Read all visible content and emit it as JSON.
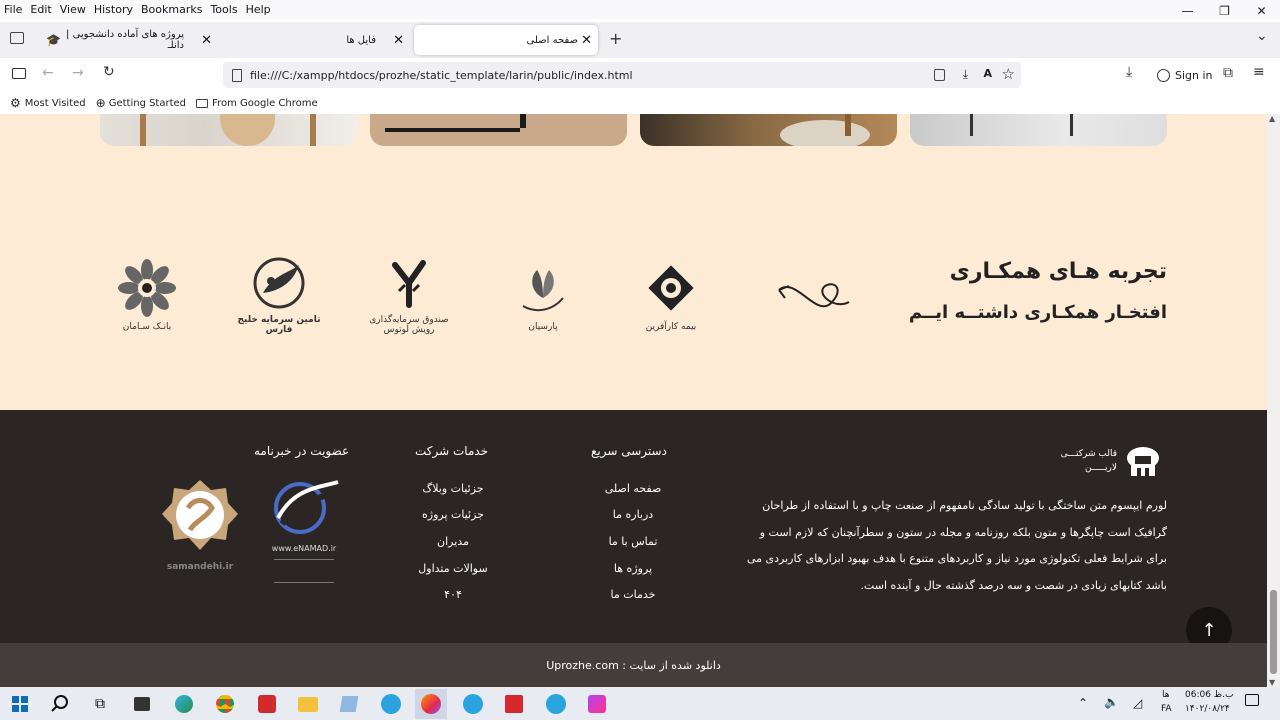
{
  "menu": [
    "File",
    "Edit",
    "View",
    "History",
    "Bookmarks",
    "Tools",
    "Help"
  ],
  "window_controls": {
    "minimize": "—",
    "maximize": "❐",
    "close": "✕"
  },
  "tabs": [
    {
      "label": "پروژه های آماده دانشجویی | دانلـ",
      "close": "✕"
    },
    {
      "label": "فایل ها",
      "close": "✕"
    },
    {
      "label": "صفحه اصلی",
      "close": "✕"
    }
  ],
  "new_tab": "+",
  "tab_list": "⌄",
  "url": "file:///C:/xampp/htdocs/prozhe/static_template/larin/public/index.html",
  "sign_in": "Sign in",
  "bookmarks": [
    "Most Visited",
    "Getting Started",
    "From Google Chrome"
  ],
  "cooperation": {
    "title": "تجربه هـای همکـاری",
    "subtitle": "افتخـار همکـاری داشتــه ایــم",
    "logos": [
      {
        "name": "bank-saman",
        "caption": "بانـک سـامان"
      },
      {
        "name": "khalij-fars",
        "caption": "تامین سرمایه خلیج فارس"
      },
      {
        "name": "lotus",
        "caption": "صندوق سرمایه‌گذاری رویش لوتوس"
      },
      {
        "name": "parsian",
        "caption": "پارسیان"
      },
      {
        "name": "karafarin",
        "caption": "بیمه کارآفرین"
      }
    ]
  },
  "footer": {
    "brand_line1": "قالب شرکتـــی",
    "brand_line2": "لاریـــــن",
    "about": "لورم ایپسوم متن ساختگی با تولید سادگی نامفهوم از صنعت چاپ و با استفاده از طراحان گرافیک است چاپگرها و متون بلکه روزنامه و مجله در ستون و سطرآنچنان که لازم است و برای شرایط فعلی تکنولوژی مورد نیاز و کاربردهای متنوع با هدف بهبود ابزارهای کاربردی می باشد کتابهای زیادی در شصت و سه درصد گذشته حال و آینده است.",
    "quick_title": "دسترسی سریع",
    "quick_links": [
      "صفحه اصلی",
      "درباره ما",
      "تماس با ما",
      "پروژه ها",
      "خدمات ما"
    ],
    "services_title": "خدمات شرکت",
    "services_links": [
      "جزئیات وبلاگ",
      "جزئیات پروژه",
      "مدیران",
      "سوالات متداول",
      "۴۰۴"
    ],
    "newsletter_title": "عضویت در خبرنامه",
    "enamad_text": "www.eNAMAD.ir",
    "samandehi_text": "samandehi.ir",
    "copyright": "دانلود شده از سایت : Uprozhe.com"
  },
  "tray": {
    "lang": "FA",
    "lang2": "ها",
    "time": "ب.ظ 06:06",
    "date": "۱۴۰۲/۰۸/۲۴"
  }
}
